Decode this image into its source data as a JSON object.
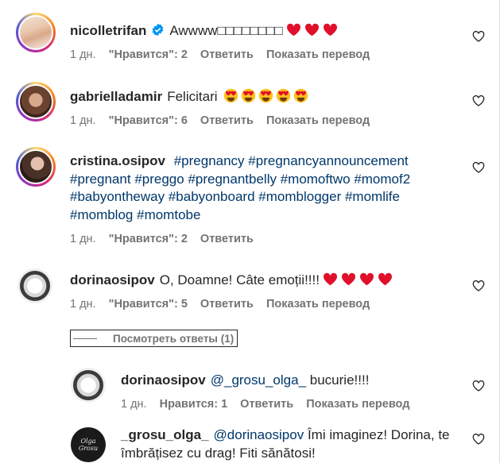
{
  "comments": [
    {
      "username": "nicolletrifan",
      "verified": true,
      "text": "Awwww□□□□□□□□",
      "time": "1 дн.",
      "likes": "\"Нравится\": 2",
      "reply": "Ответить",
      "translate": "Показать перевод"
    },
    {
      "username": "gabrielladamir",
      "text": "Felicitari",
      "time": "1 дн.",
      "likes": "\"Нравится\": 6",
      "reply": "Ответить",
      "translate": "Показать перевод"
    },
    {
      "username": "cristina.osipov",
      "hashtags": [
        "#pregnancy",
        "#pregnancyannouncement",
        "#pregnant",
        "#preggo",
        "#pregnantbelly",
        "#momoftwo",
        "#momof2",
        "#babyontheway",
        "#babyonboard",
        "#momblogger",
        "#momlife",
        "#momblog",
        "#momtobe"
      ],
      "time": "1 дн.",
      "likes": "\"Нравится\": 2",
      "reply": "Ответить"
    },
    {
      "username": "dorinaosipov",
      "text": "O, Doamne! Câte emoții!!!!",
      "time": "1 дн.",
      "likes": "\"Нравится\": 5",
      "reply": "Ответить",
      "translate": "Показать перевод"
    }
  ],
  "view_replies": "Посмотреть ответы (1)",
  "replies": [
    {
      "username": "dorinaosipov",
      "mention": "@_grosu_olga_",
      "text": "bucurie!!!!",
      "time": "1 дн.",
      "likes": "Нравится: 1",
      "reply": "Ответить",
      "translate": "Показать перевод"
    },
    {
      "username": "_grosu_olga_",
      "mention": "@dorinaosipov",
      "text": "Îmi imaginez! Dorina, te îmbrățisez cu drag! Fiti sănătosi!",
      "avatar_text": "Olga Grosu"
    }
  ],
  "colors": {
    "link": "#00376b",
    "verified": "#0095f6",
    "heart_emoji": "#e0102b",
    "muted": "#737373"
  }
}
